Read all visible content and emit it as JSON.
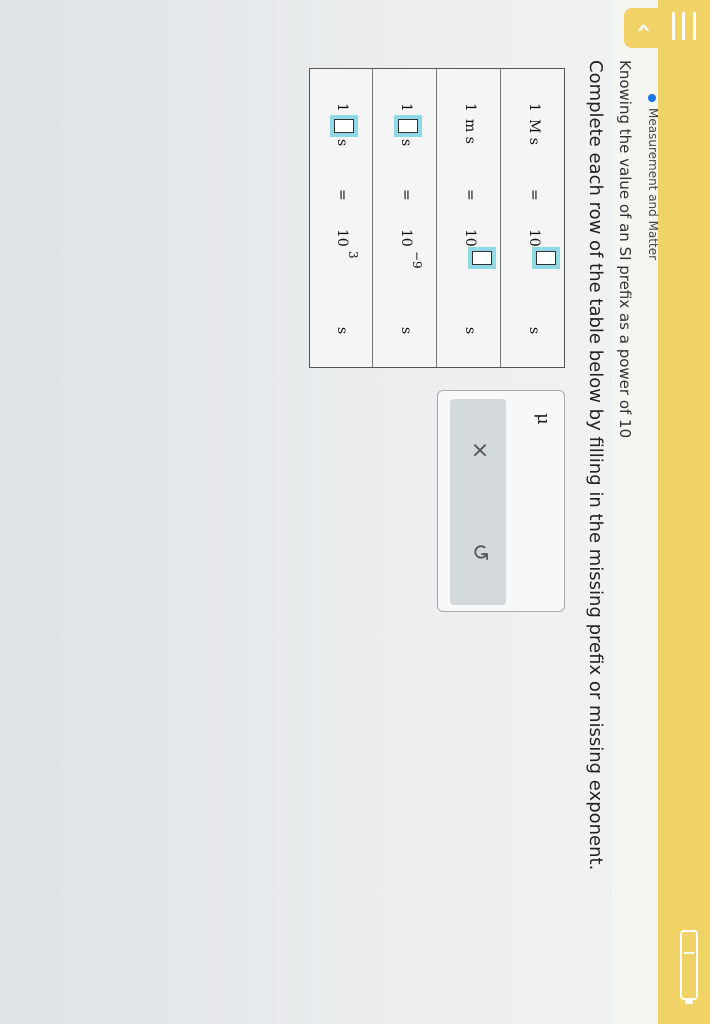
{
  "header": {
    "topic": "Measurement and Matter",
    "subtitle": "Knowing the value of an SI prefix as a power of 10",
    "back_glyph": "‹"
  },
  "question": {
    "instruction": "Complete each row of the table below by filling in the missing prefix or missing exponent."
  },
  "table": {
    "rows": [
      {
        "lhs_num": "1",
        "lhs_unit": "M s",
        "equals": "=",
        "base": "10",
        "exp": "",
        "rhs_unit": "s"
      },
      {
        "lhs_num": "1",
        "lhs_unit": "m s",
        "equals": "=",
        "base": "10",
        "exp": "",
        "rhs_unit": "s"
      },
      {
        "lhs_num": "1",
        "lhs_unit": "s",
        "equals": "=",
        "base": "10",
        "exp": "−9",
        "rhs_unit": "s"
      },
      {
        "lhs_num": "1",
        "lhs_unit": "s",
        "equals": "=",
        "base": "10",
        "exp": "3",
        "rhs_unit": "s"
      }
    ]
  },
  "panel": {
    "symbol": "μ",
    "clear_glyph": "×",
    "undo_glyph": "↺"
  },
  "colors": {
    "header": "#f0d266",
    "highlight": "#8fd9e6"
  }
}
